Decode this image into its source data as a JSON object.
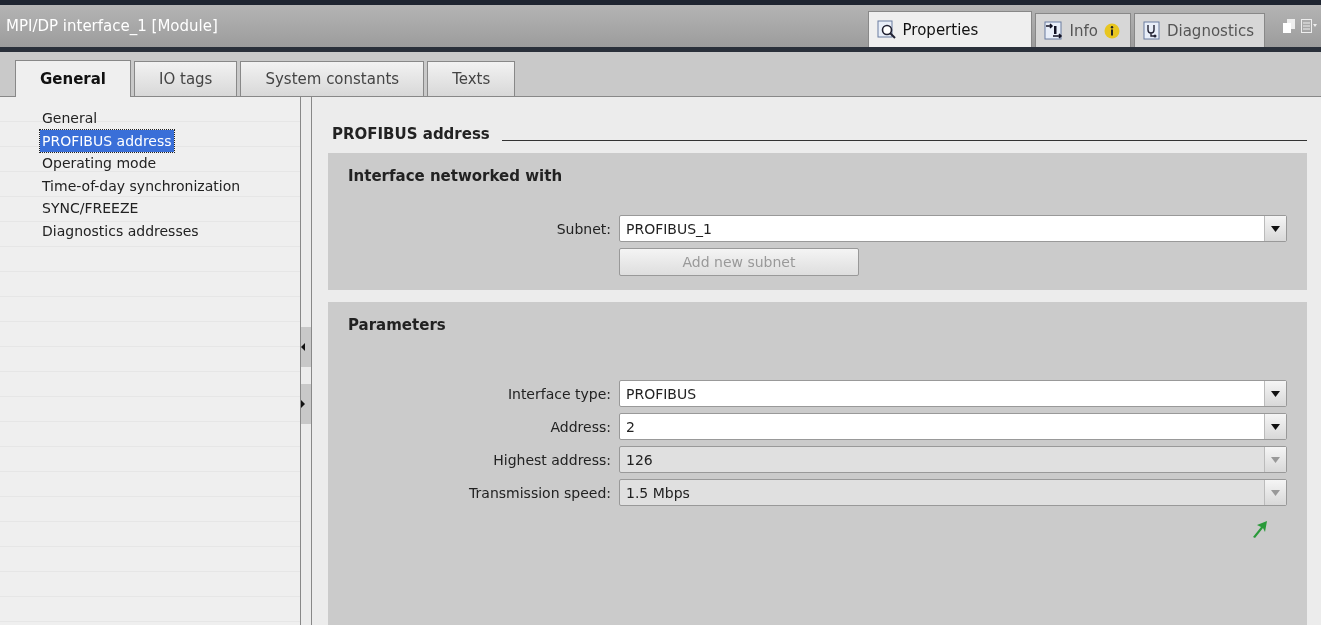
{
  "window": {
    "title": "MPI/DP interface_1 [Module]"
  },
  "panel_tabs": [
    {
      "label": "Properties",
      "selected": true,
      "kind": "properties"
    },
    {
      "label": "Info",
      "selected": false,
      "kind": "info"
    },
    {
      "label": "Diagnostics",
      "selected": false,
      "kind": "diagnostics"
    }
  ],
  "tabs": [
    {
      "label": "General",
      "selected": true
    },
    {
      "label": "IO tags",
      "selected": false
    },
    {
      "label": "System constants",
      "selected": false
    },
    {
      "label": "Texts",
      "selected": false
    }
  ],
  "sidebar": {
    "items": [
      {
        "label": "General",
        "selected": false
      },
      {
        "label": "PROFIBUS address",
        "selected": true
      },
      {
        "label": "Operating mode",
        "selected": false
      },
      {
        "label": "Time-of-day synchronization",
        "selected": false
      },
      {
        "label": "SYNC/FREEZE",
        "selected": false
      },
      {
        "label": "Diagnostics addresses",
        "selected": false
      }
    ]
  },
  "section": {
    "title": "PROFIBUS address",
    "groups": [
      {
        "title": "Interface networked with",
        "fields": [
          {
            "label": "Subnet:",
            "value": "PROFIBUS_1",
            "disabled": false
          }
        ],
        "button": {
          "label": "Add new subnet",
          "disabled": true
        },
        "link_arrow": false
      },
      {
        "title": "Parameters",
        "fields": [
          {
            "label": "Interface type:",
            "value": "PROFIBUS",
            "disabled": false
          },
          {
            "label": "Address:",
            "value": "2",
            "disabled": false
          },
          {
            "label": "Highest address:",
            "value": "126",
            "disabled": true
          },
          {
            "label": "Transmission speed:",
            "value": "1.5 Mbps",
            "disabled": true
          }
        ],
        "link_arrow": true
      }
    ]
  }
}
